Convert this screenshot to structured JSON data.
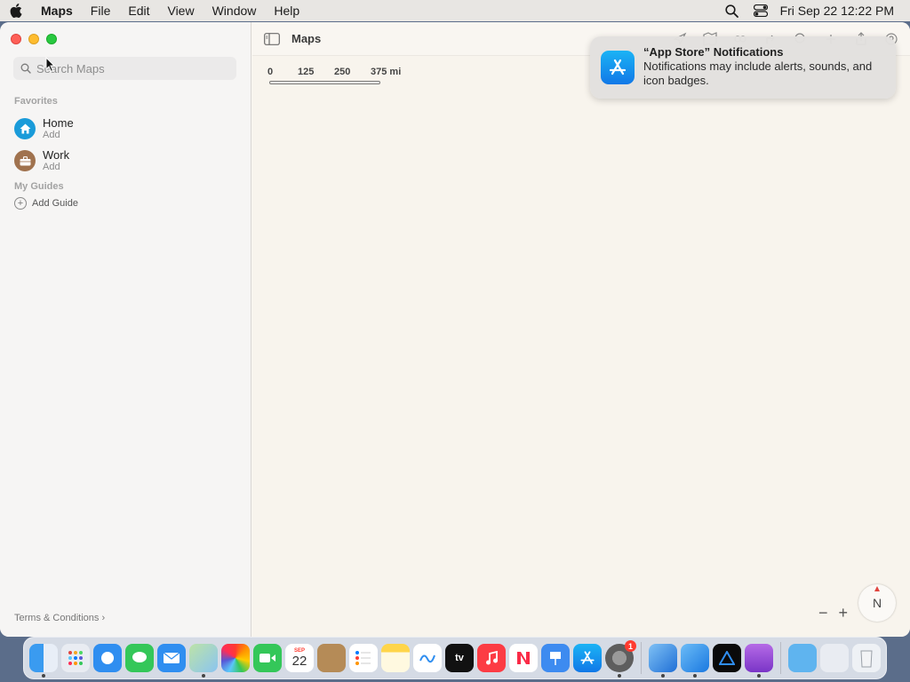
{
  "menubar": {
    "app_name": "Maps",
    "items": [
      "File",
      "Edit",
      "View",
      "Window",
      "Help"
    ],
    "clock": "Fri Sep 22  12:22 PM"
  },
  "sidebar": {
    "search_placeholder": "Search Maps",
    "favorites_header": "Favorites",
    "favorites": [
      {
        "title": "Home",
        "subtitle": "Add",
        "icon": "house-icon",
        "color": "#1a9bd9"
      },
      {
        "title": "Work",
        "subtitle": "Add",
        "icon": "briefcase-icon",
        "color": "#a0724e"
      }
    ],
    "guides_header": "My Guides",
    "add_guide_label": "Add Guide",
    "terms_label": "Terms & Conditions"
  },
  "map": {
    "title": "Maps",
    "scale_labels": [
      "0",
      "125",
      "250",
      "375 mi"
    ],
    "compass_label": "N",
    "zoom_out": "−",
    "zoom_in": "+"
  },
  "notification": {
    "title": "“App Store” Notifications",
    "body": "Notifications may include alerts, sounds, and icon badges.",
    "icon": "app-store-icon"
  },
  "dock": {
    "calendar_month": "SEP",
    "calendar_day": "22",
    "tv_label": "tv",
    "settings_badge": "1"
  }
}
